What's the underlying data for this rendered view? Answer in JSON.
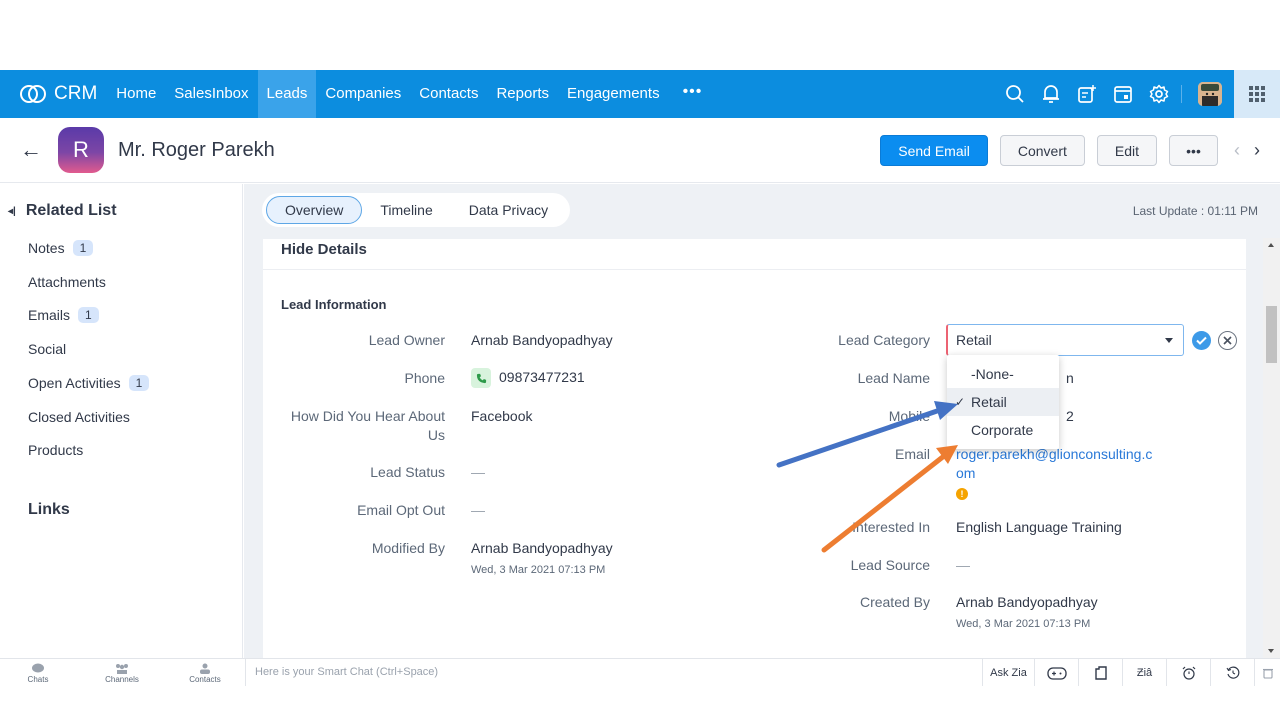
{
  "nav": {
    "logo_text": "CRM",
    "items": [
      {
        "label": "Home",
        "active": false
      },
      {
        "label": "SalesInbox",
        "active": false
      },
      {
        "label": "Leads",
        "active": true
      },
      {
        "label": "Companies",
        "active": false
      },
      {
        "label": "Contacts",
        "active": false
      },
      {
        "label": "Reports",
        "active": false
      },
      {
        "label": "Engagements",
        "active": false
      }
    ],
    "more_label": "•••",
    "right_icons": [
      "search-icon",
      "bell-icon",
      "add-note-icon",
      "calendar-icon",
      "gear-icon",
      "profile-avatar",
      "app-grid-icon"
    ],
    "brand_color": "#0c8ddf"
  },
  "header": {
    "back_label": "←",
    "avatar_letter": "R",
    "record_name": "Mr. Roger Parekh",
    "buttons": {
      "send_email": "Send Email",
      "convert": "Convert",
      "edit": "Edit",
      "more": "•••"
    },
    "prev_label": "‹",
    "next_label": "›"
  },
  "sidebar": {
    "related_list_title": "Related List",
    "items": [
      {
        "label": "Notes",
        "count": "1"
      },
      {
        "label": "Attachments",
        "count": null
      },
      {
        "label": "Emails",
        "count": "1"
      },
      {
        "label": "Social",
        "count": null
      },
      {
        "label": "Open Activities",
        "count": "1"
      },
      {
        "label": "Closed Activities",
        "count": null
      },
      {
        "label": "Products",
        "count": null
      }
    ],
    "links_title": "Links"
  },
  "main": {
    "tabs": [
      {
        "label": "Overview",
        "active": true
      },
      {
        "label": "Timeline",
        "active": false
      },
      {
        "label": "Data Privacy",
        "active": false
      }
    ],
    "last_update": "Last Update : 01:11 PM",
    "hide_details": "Hide Details",
    "section_title": "Lead Information",
    "left_fields": [
      {
        "label": "Lead Owner",
        "value": "Arnab Bandyopadhyay"
      },
      {
        "label": "Phone",
        "value": "09873477231"
      },
      {
        "label": "How Did You Hear About Us",
        "value": "Facebook"
      },
      {
        "label": "Lead Status",
        "value": "—"
      },
      {
        "label": "Email Opt Out",
        "value": "—"
      },
      {
        "label": "Modified By",
        "value": "Arnab Bandyopadhyay",
        "sub": "Wed, 3 Mar 2021 07:13 PM"
      }
    ],
    "right_fields": [
      {
        "label": "Lead Category",
        "value": "Retail"
      },
      {
        "label": "Lead Name",
        "value": "n"
      },
      {
        "label": "Mobile",
        "value": "2"
      },
      {
        "label": "Email",
        "value": "roger.parekh@glionconsulting.com"
      },
      {
        "label": "Interested In",
        "value": "English Language Training"
      },
      {
        "label": "Lead Source",
        "value": "—"
      },
      {
        "label": "Created By",
        "value": "Arnab Bandyopadhyay",
        "sub": "Wed, 3 Mar 2021 07:13 PM"
      }
    ],
    "lead_category_select": {
      "value": "Retail",
      "options": [
        {
          "label": "-None-",
          "selected": false
        },
        {
          "label": "Retail",
          "selected": true
        },
        {
          "label": "Corporate",
          "selected": false
        }
      ]
    }
  },
  "annotations": {
    "blue_arrow_color": "#4472c4",
    "orange_arrow_color": "#ed7d31"
  },
  "footer": {
    "left_items": [
      {
        "label": "Chats"
      },
      {
        "label": "Channels"
      },
      {
        "label": "Contacts"
      }
    ],
    "smart_chat_placeholder": "Here is your Smart Chat (Ctrl+Space)",
    "ask_zia": "Ask Zia",
    "right_icons": [
      "gamepad-icon",
      "notes-icon",
      "zia-icon",
      "alarm-icon",
      "history-icon",
      "trash-icon"
    ]
  }
}
